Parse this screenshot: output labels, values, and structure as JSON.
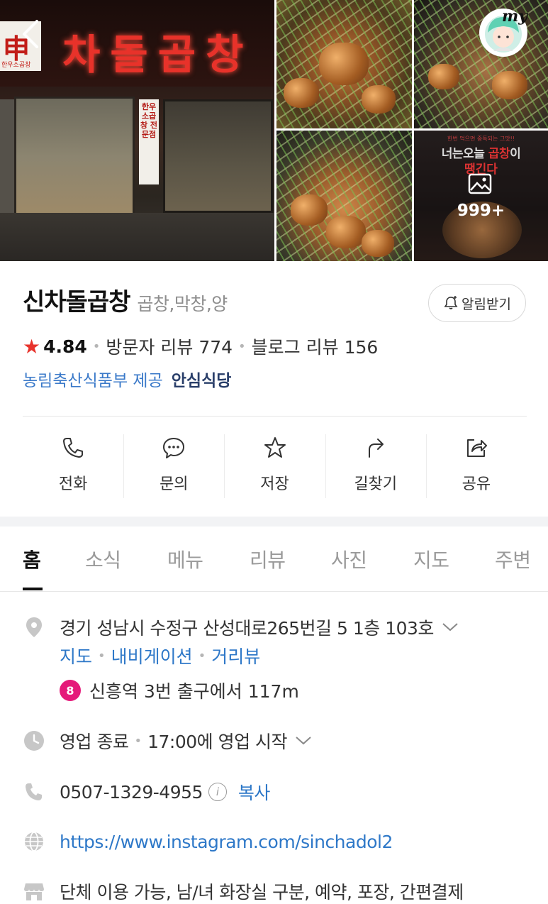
{
  "gallery": {
    "main_sign": "차돌곱창",
    "main_sign_left": "申",
    "main_sign_left_small": "한우소곱창",
    "vertical_sign": "한우소곱창 전문점",
    "promo_top": "한번 먹으면 중독되는 그맛!!",
    "promo_title_a": "너는오늘 ",
    "promo_title_b": "곱창",
    "promo_title_c": "이",
    "promo_sub": "땡긴다",
    "more_count": "999+"
  },
  "top": {
    "back_icon": "chevron-left-icon",
    "my_label": "my"
  },
  "place": {
    "name": "신차돌곱창",
    "category": "곱창,막창,양",
    "notify_label": "알림받기",
    "rating": "4.84",
    "visitor_reviews": "방문자 리뷰 774",
    "blog_reviews": "블로그 리뷰 156",
    "cert_source": "농림축산식품부 제공",
    "cert_badge": "안심식당"
  },
  "actions": [
    {
      "label": "전화",
      "icon": "phone-icon"
    },
    {
      "label": "문의",
      "icon": "chat-icon"
    },
    {
      "label": "저장",
      "icon": "star-icon"
    },
    {
      "label": "길찾기",
      "icon": "directions-icon"
    },
    {
      "label": "공유",
      "icon": "share-icon"
    }
  ],
  "tabs": [
    "홈",
    "소식",
    "메뉴",
    "리뷰",
    "사진",
    "지도",
    "주변"
  ],
  "details": {
    "address": "경기 성남시 수정구 산성대로265번길 5 1층 103호",
    "links": [
      "지도",
      "내비게이션",
      "거리뷰"
    ],
    "subway_line": "8",
    "subway_text": "신흥역 3번 출구에서 117m",
    "hours_status": "영업 종료",
    "hours_next": "17:00에 영업 시작",
    "phone": "0507-1329-4955",
    "copy_label": "복사",
    "website": "https://www.instagram.com/sinchadol2",
    "facilities": "단체 이용 가능, 남/녀 화장실 구분, 예약, 포장, 간편결제"
  },
  "colors": {
    "accent_link": "#2e78c8",
    "star": "#e8332c",
    "subway_line8": "#e5197a"
  }
}
